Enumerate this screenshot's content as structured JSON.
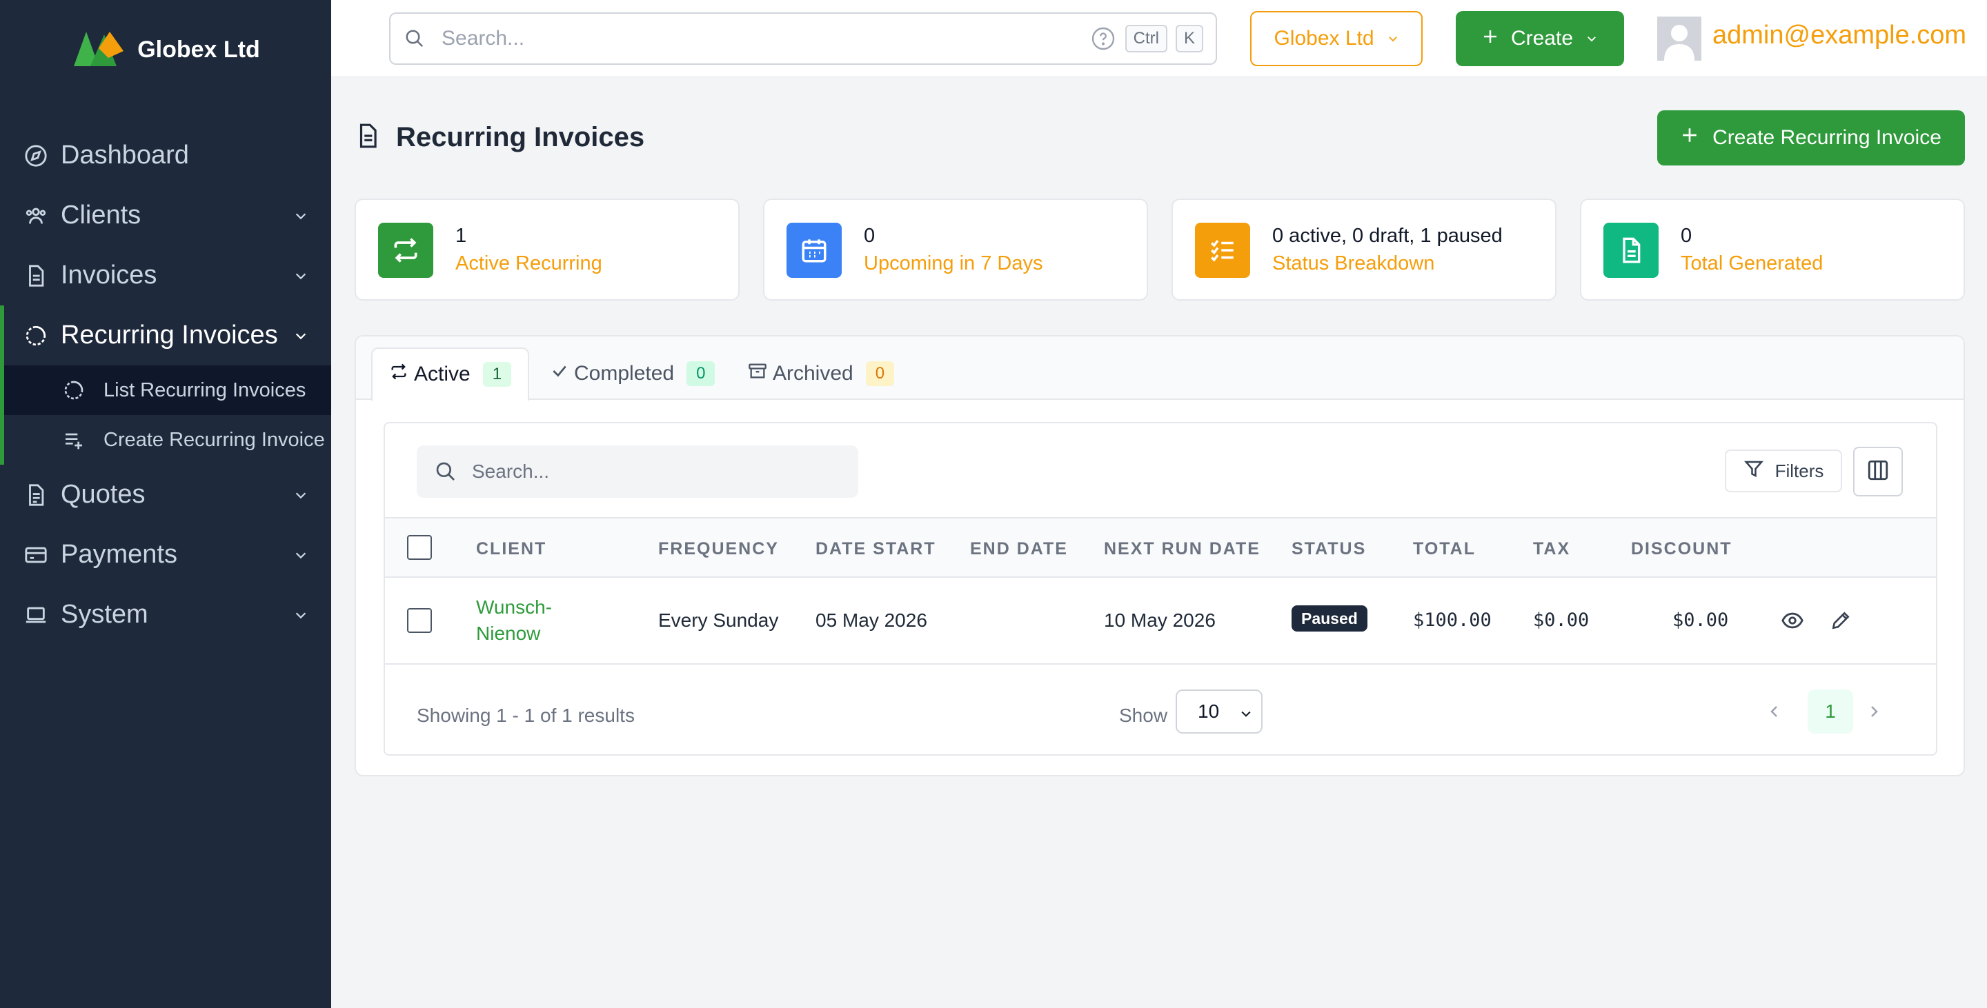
{
  "brand": {
    "name": "Globex Ltd"
  },
  "sidebar": {
    "items": [
      {
        "label": "Dashboard",
        "icon": "compass-icon"
      },
      {
        "label": "Clients",
        "icon": "users-icon"
      },
      {
        "label": "Invoices",
        "icon": "file-text-icon"
      },
      {
        "label": "Recurring Invoices",
        "icon": "recurring-icon"
      },
      {
        "label": "Quotes",
        "icon": "file-quote-icon"
      },
      {
        "label": "Payments",
        "icon": "credit-card-icon"
      },
      {
        "label": "System",
        "icon": "laptop-icon"
      }
    ],
    "sub_items": [
      {
        "label": "List Recurring Invoices",
        "icon": "recurring-icon"
      },
      {
        "label": "Create Recurring Invoice",
        "icon": "list-plus-icon"
      }
    ]
  },
  "topbar": {
    "search_placeholder": "Search...",
    "kbd_ctrl": "Ctrl",
    "kbd_k": "K",
    "company": "Globex Ltd",
    "create_label": "Create",
    "user_email": "admin@example.com"
  },
  "page": {
    "title": "Recurring Invoices",
    "create_button": "Create Recurring Invoice"
  },
  "stats": [
    {
      "value": "1",
      "label": "Active Recurring",
      "color": "#2f9a3b",
      "icon": "repeat-icon"
    },
    {
      "value": "0",
      "label": "Upcoming in 7 Days",
      "color": "#3b82f6",
      "icon": "calendar-icon"
    },
    {
      "value": "0 active, 0 draft, 1 paused",
      "label": "Status Breakdown",
      "color": "#f59e0b",
      "icon": "checklist-icon"
    },
    {
      "value": "0",
      "label": "Total Generated",
      "color": "#10b981",
      "icon": "document-icon"
    }
  ],
  "tabs": [
    {
      "label": "Active",
      "count": "1"
    },
    {
      "label": "Completed",
      "count": "0"
    },
    {
      "label": "Archived",
      "count": "0"
    }
  ],
  "table": {
    "search_placeholder": "Search...",
    "filters_label": "Filters",
    "columns": [
      "CLIENT",
      "FREQUENCY",
      "DATE START",
      "END DATE",
      "NEXT RUN DATE",
      "STATUS",
      "TOTAL",
      "TAX",
      "DISCOUNT"
    ],
    "rows": [
      {
        "client_line1": "Wunsch-",
        "client_line2": "Nienow",
        "frequency": "Every Sunday",
        "date_start": "05 May 2026",
        "end_date": "",
        "next_run_date": "10 May 2026",
        "status": "Paused",
        "total": "$100.00",
        "tax": "$0.00",
        "discount": "$0.00"
      }
    ],
    "footer_text": "Showing 1 - 1 of 1 results",
    "show_label": "Show",
    "page_size": "10",
    "current_page": "1"
  }
}
